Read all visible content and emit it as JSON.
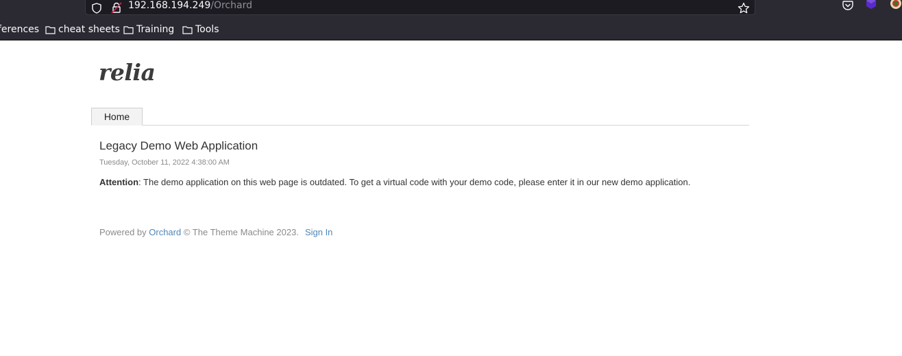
{
  "browser": {
    "url_host": "192.168.194.249",
    "url_path": "/Orchard",
    "bookmarks": [
      {
        "label": "ferences"
      },
      {
        "label": "cheat sheets"
      },
      {
        "label": "Training"
      },
      {
        "label": "Tools"
      }
    ],
    "colors": {
      "chrome_bg": "#2b2a33",
      "urlbar_bg": "#1c1b22",
      "text": "#fbfbfe",
      "ext1": "#592acb",
      "ext2": "#c0392b"
    }
  },
  "site": {
    "title": "relia",
    "nav": [
      {
        "label": "Home"
      }
    ]
  },
  "post": {
    "title": "Legacy Demo Web Application",
    "date": "Tuesday, October 11, 2022 4:38:00 AM",
    "body_strong": "Attention",
    "body_text": ": The demo application on this web page is outdated. To get a virtual code with your demo code, please enter it in our new demo application."
  },
  "footer": {
    "powered_by": "Powered by ",
    "orchard_link": "Orchard",
    "copyright": " © The Theme Machine 2023.",
    "signin_link": "Sign In",
    "link_color": "#4f86b8"
  },
  "icons": [
    "shield-icon",
    "lock-icon",
    "star-icon",
    "pocket-icon",
    "extension-icon",
    "folder-icon"
  ]
}
